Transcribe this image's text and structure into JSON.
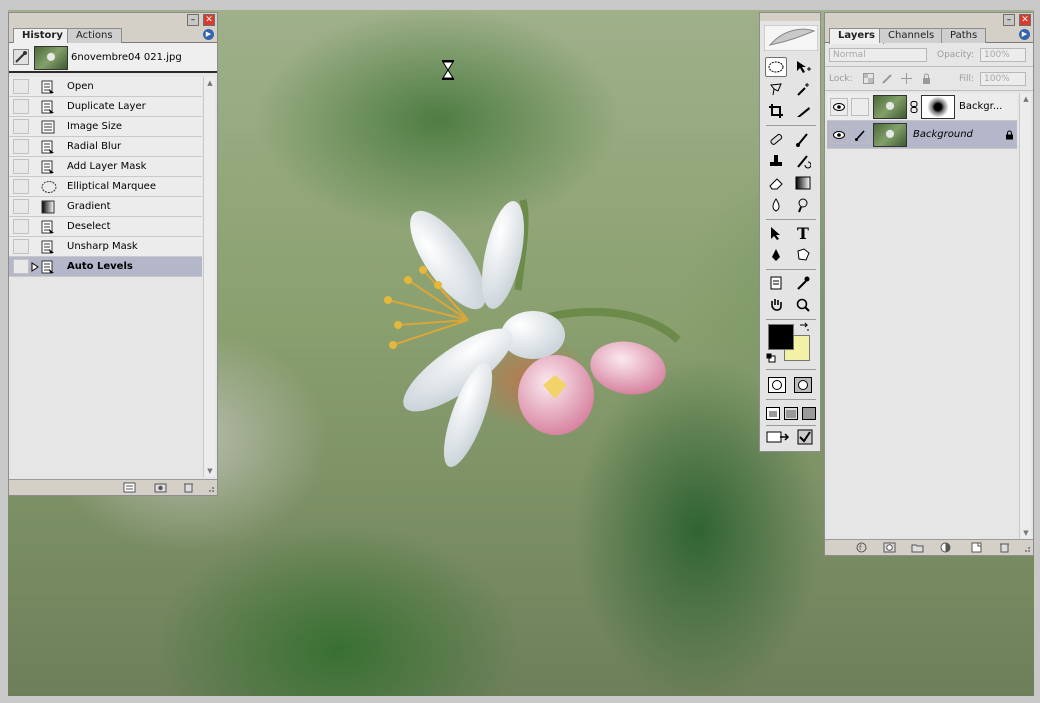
{
  "history_panel": {
    "tabs": [
      {
        "label": "History",
        "active": true
      },
      {
        "label": "Actions",
        "active": false
      }
    ],
    "snapshot": {
      "label": "6novembre04 021.jpg"
    },
    "items": [
      {
        "label": "Open",
        "icon": "history-state-icon"
      },
      {
        "label": "Duplicate Layer",
        "icon": "history-state-icon"
      },
      {
        "label": "Image Size",
        "icon": "image-size-icon"
      },
      {
        "label": "Radial Blur",
        "icon": "history-state-icon"
      },
      {
        "label": "Add Layer Mask",
        "icon": "history-state-icon"
      },
      {
        "label": "Elliptical Marquee",
        "icon": "elliptical-marquee-icon"
      },
      {
        "label": "Gradient",
        "icon": "gradient-icon"
      },
      {
        "label": "Deselect",
        "icon": "history-state-icon"
      },
      {
        "label": "Unsharp Mask",
        "icon": "history-state-icon"
      },
      {
        "label": "Auto Levels",
        "icon": "history-state-icon",
        "current": true
      }
    ]
  },
  "toolbox": {
    "foreground_color": "#000000",
    "background_color": "#f3f1a6"
  },
  "layers_panel": {
    "tabs": [
      {
        "label": "Layers",
        "active": true
      },
      {
        "label": "Channels",
        "active": false
      },
      {
        "label": "Paths",
        "active": false
      }
    ],
    "blend_mode": "Normal",
    "opacity_label": "Opacity:",
    "opacity_value": "100%",
    "lock_label": "Lock:",
    "fill_label": "Fill:",
    "fill_value": "100%",
    "layers": [
      {
        "name": "Backgr...",
        "has_mask": true,
        "visible": true,
        "selected": false
      },
      {
        "name": "Background",
        "has_mask": false,
        "visible": true,
        "selected": true,
        "locked": true
      }
    ]
  },
  "colors": {
    "panel_bg": "#e6e6e6",
    "selection": "#b3b7c9",
    "close_red": "#d93a2b",
    "menu_blue": "#3563b0"
  }
}
